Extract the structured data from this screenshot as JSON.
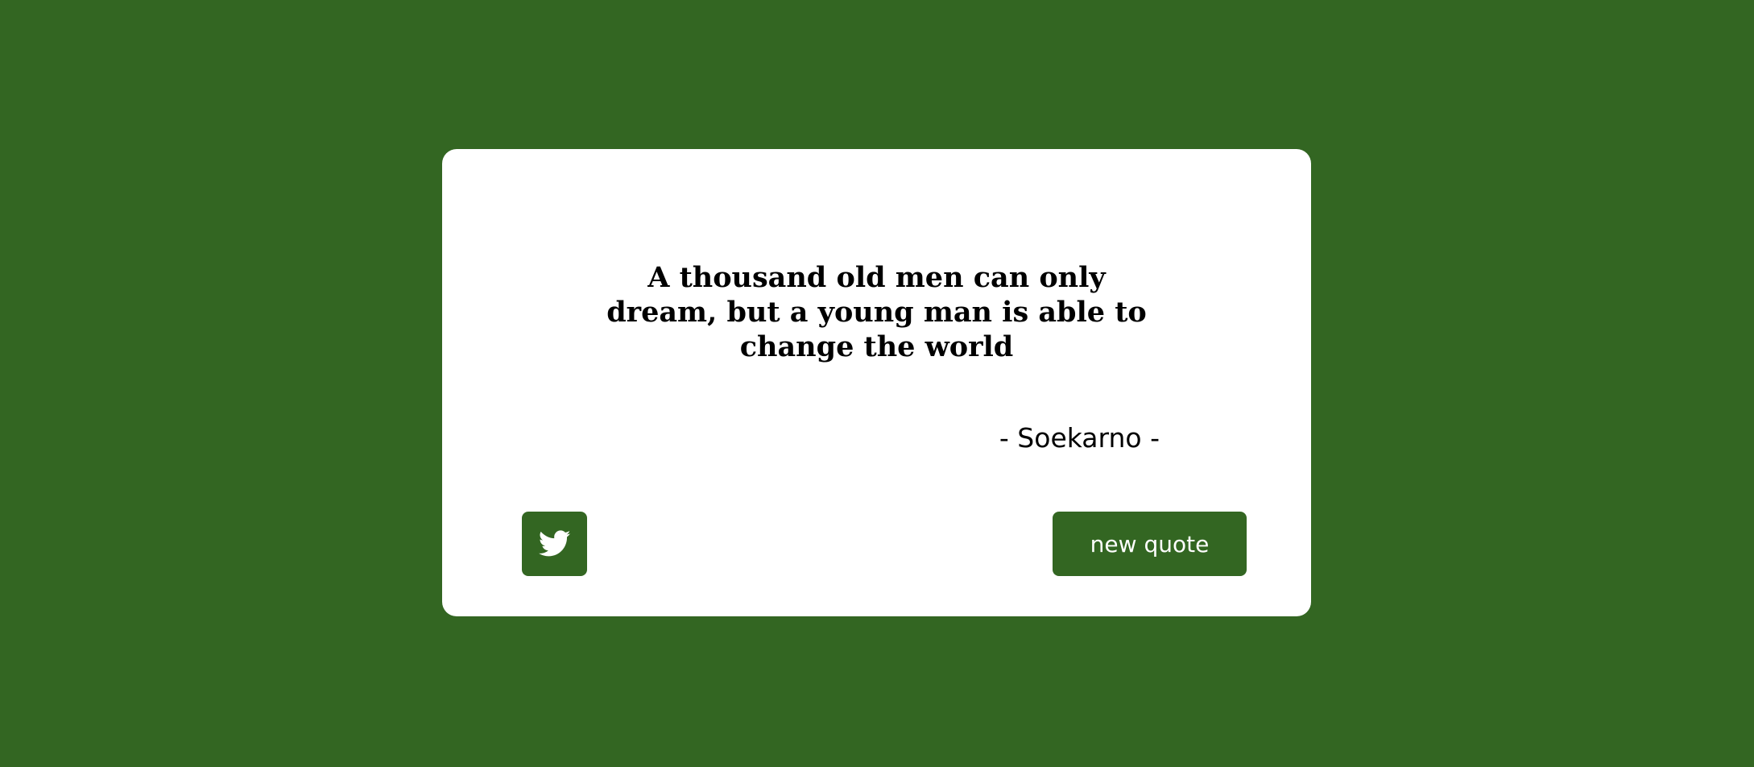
{
  "colors": {
    "background": "#336622",
    "card": "#ffffff",
    "button": "#336622",
    "button_text": "#ffffff",
    "text": "#000000"
  },
  "quote": {
    "text": "A thousand old men can only dream, but a young man is able to change the world",
    "author": "- Soekarno -"
  },
  "actions": {
    "tweet_icon": "twitter-icon",
    "new_quote_label": "new quote"
  }
}
